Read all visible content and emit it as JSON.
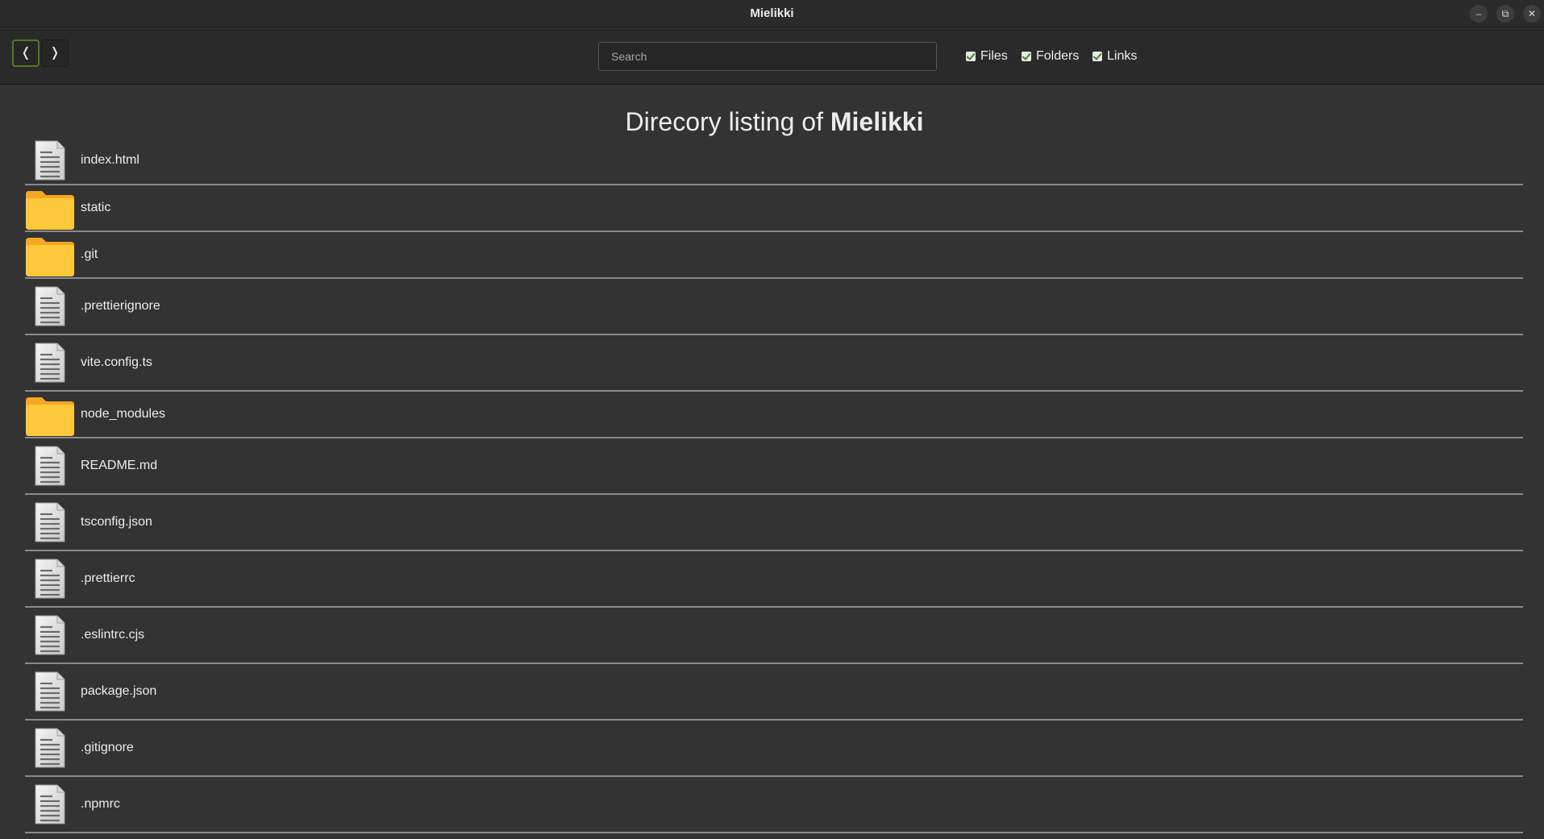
{
  "window": {
    "title": "Mielikki",
    "minimize_glyph": "–",
    "maximize_glyph": "⧉",
    "close_glyph": "✕"
  },
  "toolbar": {
    "back_glyph": "❬",
    "forward_glyph": "❭",
    "search_placeholder": "Search",
    "search_value": "",
    "filters": [
      {
        "label": "Files",
        "checked": true
      },
      {
        "label": "Folders",
        "checked": true
      },
      {
        "label": "Links",
        "checked": true
      }
    ]
  },
  "heading": {
    "prefix": "Direcory listing of ",
    "folder": "Mielikki"
  },
  "listing": [
    {
      "name": "index.html",
      "type": "file",
      "icon": "file-icon"
    },
    {
      "name": "static",
      "type": "folder",
      "icon": "folder-icon"
    },
    {
      "name": ".git",
      "type": "folder",
      "icon": "folder-icon"
    },
    {
      "name": ".prettierignore",
      "type": "file",
      "icon": "file-icon"
    },
    {
      "name": "vite.config.ts",
      "type": "file",
      "icon": "file-icon"
    },
    {
      "name": "node_modules",
      "type": "folder",
      "icon": "folder-icon"
    },
    {
      "name": "README.md",
      "type": "file",
      "icon": "file-icon"
    },
    {
      "name": "tsconfig.json",
      "type": "file",
      "icon": "file-icon"
    },
    {
      "name": ".prettierrc",
      "type": "file",
      "icon": "file-icon"
    },
    {
      "name": ".eslintrc.cjs",
      "type": "file",
      "icon": "file-icon"
    },
    {
      "name": "package.json",
      "type": "file",
      "icon": "file-icon"
    },
    {
      "name": ".gitignore",
      "type": "file",
      "icon": "file-icon"
    },
    {
      "name": ".npmrc",
      "type": "file",
      "icon": "file-icon"
    }
  ],
  "colors": {
    "background": "#333333",
    "toolbar": "#2a2a2a",
    "accent": "#4f7a21",
    "folder": "#fbc02d",
    "divider": "#8a8a8a"
  }
}
